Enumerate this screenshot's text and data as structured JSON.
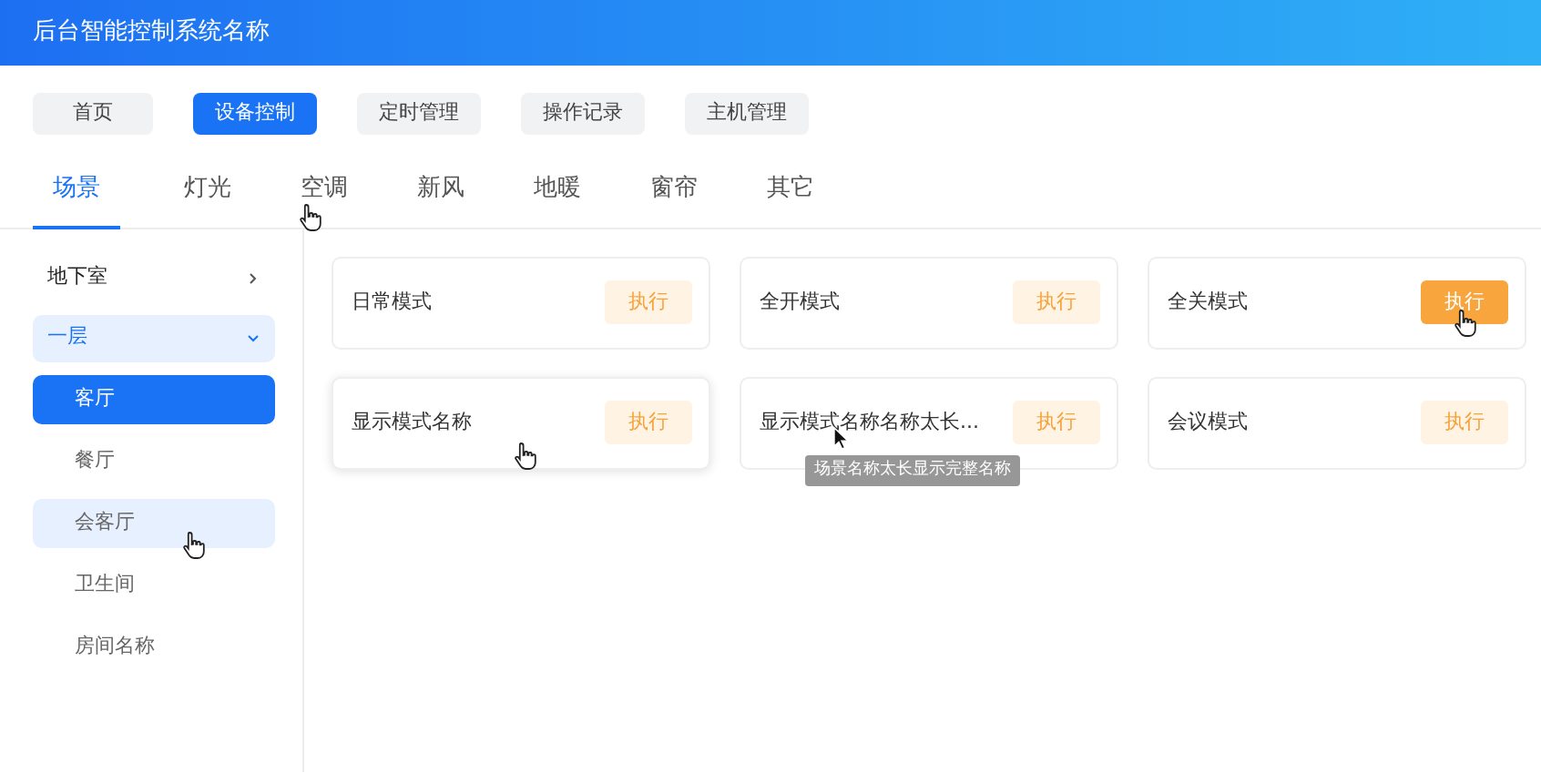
{
  "app_title": "后台智能控制系统名称",
  "nav": [
    {
      "label": "首页",
      "selected": false
    },
    {
      "label": "设备控制",
      "selected": true
    },
    {
      "label": "定时管理",
      "selected": false
    },
    {
      "label": "操作记录",
      "selected": false
    },
    {
      "label": "主机管理",
      "selected": false
    }
  ],
  "tabs": [
    {
      "label": "场景",
      "selected": true
    },
    {
      "label": "灯光",
      "selected": false
    },
    {
      "label": "空调",
      "selected": false
    },
    {
      "label": "新风",
      "selected": false
    },
    {
      "label": "地暖",
      "selected": false
    },
    {
      "label": "窗帘",
      "selected": false
    },
    {
      "label": "其它",
      "selected": false
    }
  ],
  "sidebar": [
    {
      "label": "地下室",
      "expanded": false
    },
    {
      "label": "一层",
      "expanded": true,
      "children": [
        {
          "label": "客厅",
          "selected": true,
          "hovered": false
        },
        {
          "label": "餐厅",
          "selected": false,
          "hovered": false
        },
        {
          "label": "会客厅",
          "selected": false,
          "hovered": true
        },
        {
          "label": "卫生间",
          "selected": false,
          "hovered": false
        },
        {
          "label": "房间名称",
          "selected": false,
          "hovered": false
        }
      ]
    }
  ],
  "scenes": [
    {
      "name": "日常模式",
      "button": "执行",
      "card_hovered": false,
      "button_hovered": false
    },
    {
      "name": "全开模式",
      "button": "执行",
      "card_hovered": false,
      "button_hovered": false
    },
    {
      "name": "全关模式",
      "button": "执行",
      "card_hovered": false,
      "button_hovered": true
    },
    {
      "name": "显示模式名称",
      "button": "执行",
      "card_hovered": true,
      "button_hovered": false
    },
    {
      "name": "显示模式名称名称太长...",
      "button": "执行",
      "card_hovered": false,
      "button_hovered": false,
      "tooltip": "场景名称太长显示完整名称"
    },
    {
      "name": "会议模式",
      "button": "执行",
      "card_hovered": false,
      "button_hovered": false
    }
  ]
}
